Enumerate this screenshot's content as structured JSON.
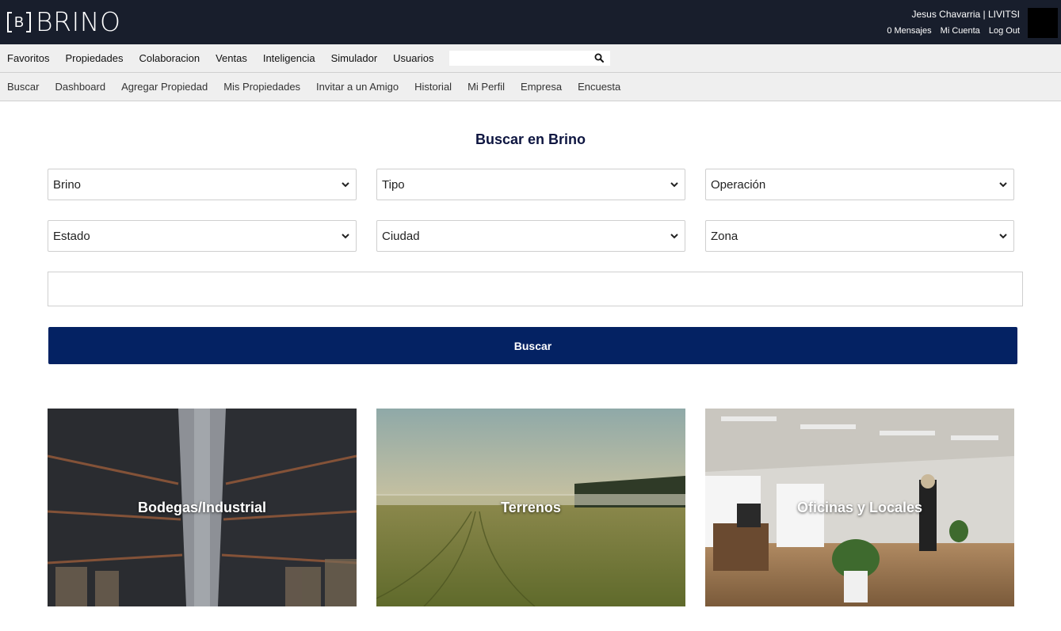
{
  "brand": {
    "logo_letter": "B",
    "name": "BRINO"
  },
  "user": {
    "display": "Jesus Chavarria | LIVITSI",
    "links": [
      "0 Mensajes",
      "Mi Cuenta",
      "Log Out"
    ]
  },
  "main_nav": {
    "items": [
      "Favoritos",
      "Propiedades",
      "Colaboracion",
      "Ventas",
      "Inteligencia",
      "Simulador",
      "Usuarios"
    ],
    "search": {
      "value": "",
      "placeholder": ""
    }
  },
  "sub_nav": {
    "items": [
      "Buscar",
      "Dashboard",
      "Agregar Propiedad",
      "Mis Propiedades",
      "Invitar a un Amigo",
      "Historial",
      "Mi Perfil",
      "Empresa",
      "Encuesta"
    ]
  },
  "search_panel": {
    "title": "Buscar en Brino",
    "selects": [
      "Brino",
      "Tipo",
      "Operación",
      "Estado",
      "Ciudad",
      "Zona"
    ],
    "keyword": {
      "value": "",
      "placeholder": ""
    },
    "button": "Buscar"
  },
  "categories": [
    "Bodegas/Industrial",
    "Terrenos",
    "Oficinas y Locales"
  ],
  "colors": {
    "header_bg": "#181e2c",
    "nav_bg": "#efefef",
    "primary_button": "#042263",
    "title_text": "#0d1540"
  },
  "icons": {
    "search": "magnifier-icon",
    "select": "chevron-down-icon"
  }
}
